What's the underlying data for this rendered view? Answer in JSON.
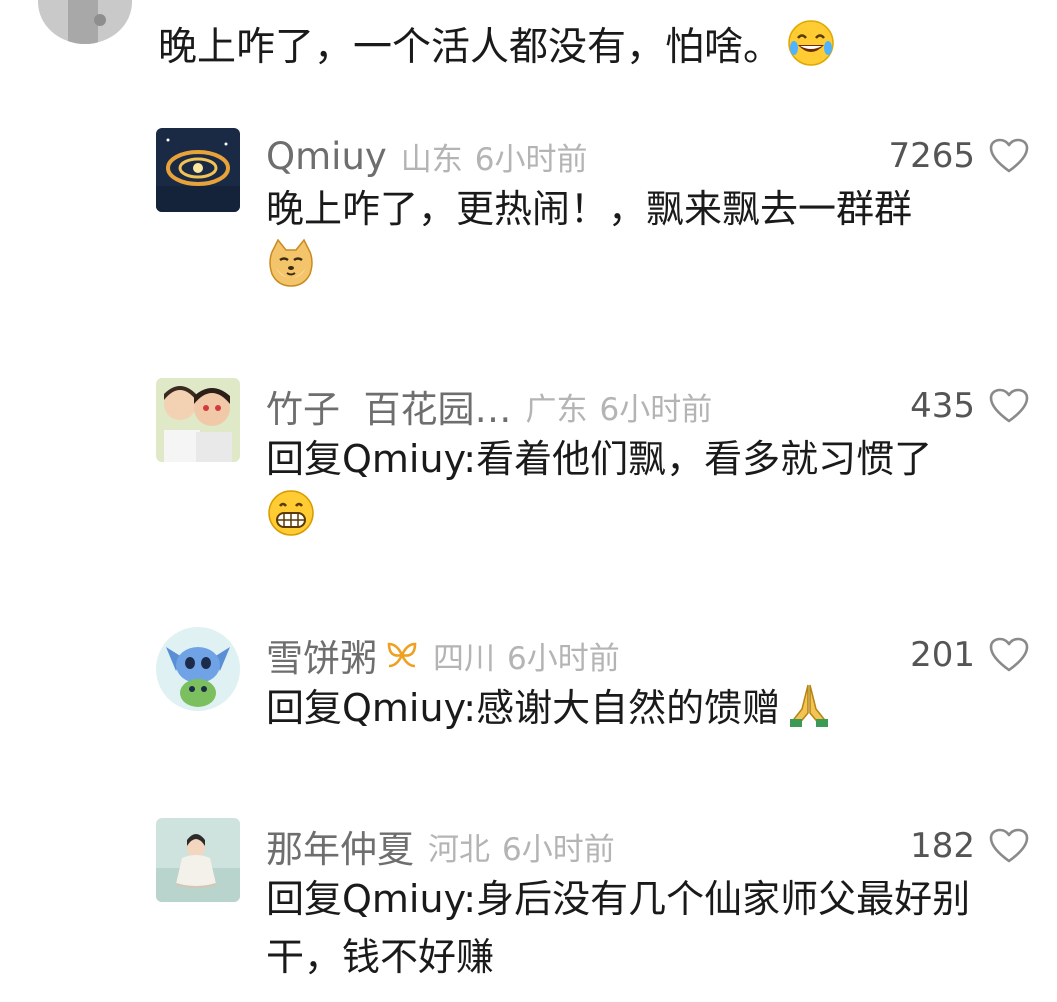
{
  "top_comment": {
    "text": "晚上咋了，一个活人都没有，怕啥。",
    "emoji": "laughing-tears-icon"
  },
  "replies": [
    {
      "username": "Qmiuy",
      "region": "山东",
      "time": "6小时前",
      "likes": "7265",
      "text": "晚上咋了，更热闹！，飘来飘去一群群",
      "emoji": "doge-icon"
    },
    {
      "username": "竹子  百花园…",
      "region": "广东",
      "time": "6小时前",
      "likes": "435",
      "text": "回复Qmiuy:看着他们飘，看多就习惯了",
      "emoji": "grin-icon"
    },
    {
      "username": "雪饼粥",
      "region": "四川",
      "time": "6小时前",
      "likes": "201",
      "text": "回复Qmiuy:感谢大自然的馈赠",
      "emoji": "pray-hands-icon",
      "badge": "ribbon-badge-icon"
    },
    {
      "username": "那年仲夏",
      "region": "河北",
      "time": "6小时前",
      "likes": "182",
      "text": "回复Qmiuy:身后没有几个仙家师父最好别干，钱不好赚"
    }
  ],
  "colors": {
    "username": "#6e6e6e",
    "meta": "#b4b4b4",
    "text": "#1a1a1a",
    "heart": "#8a8a8a"
  }
}
